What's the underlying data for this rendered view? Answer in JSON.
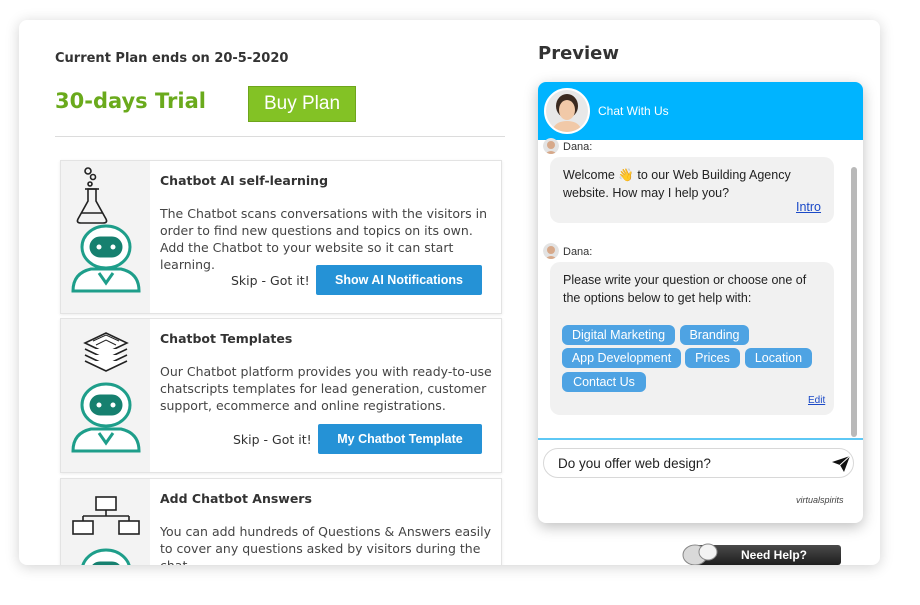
{
  "plan": {
    "ends_text": "Current Plan ends on 20-5-2020",
    "trial_label": "30-days Trial",
    "buy_label": "Buy Plan"
  },
  "features": [
    {
      "title": "Chatbot AI self-learning",
      "description": "The Chatbot scans conversations with the visitors in order to find new questions and topics on its own. Add the Chatbot to your website so it can start learning.",
      "skip_label": "Skip - Got it!",
      "button_label": "Show AI Notifications",
      "icon": "flask-robot-icon"
    },
    {
      "title": "Chatbot Templates",
      "description": "Our Chatbot platform provides you with ready-to-use chatscripts templates for lead generation, customer support, ecommerce and online registrations.",
      "skip_label": "Skip - Got it!",
      "button_label": "My Chatbot Template",
      "icon": "layers-robot-icon"
    },
    {
      "title": "Add Chatbot Answers",
      "description": "You can add hundreds of Questions & Answers easily to cover any questions asked by visitors during the chat.",
      "icon": "flowchart-robot-icon"
    }
  ],
  "preview": {
    "title": "Preview",
    "chat_title": "Chat With Us",
    "messages": [
      {
        "sender": "Dana:",
        "text_line1": "Welcome 👋 to our Web Building Agency",
        "text_line2": "website. How may I help you?",
        "link": "Intro"
      },
      {
        "sender": "Dana:",
        "text_line1": "Please write your question or choose one of",
        "text_line2": "the options below to get help with:",
        "options": [
          "Digital Marketing",
          "Branding",
          "App Development",
          "Prices",
          "Location",
          "Contact Us"
        ],
        "link": "Edit"
      }
    ],
    "input_value": "Do you offer web design?",
    "brand": "virtualspirits"
  },
  "help_widget": {
    "label": "Need Help?"
  },
  "colors": {
    "accent_green": "#83c225",
    "trial_green": "#6aaa1c",
    "button_blue": "#2592d6",
    "chat_header": "#00b4ff",
    "chip_blue": "#4ea3e3"
  }
}
